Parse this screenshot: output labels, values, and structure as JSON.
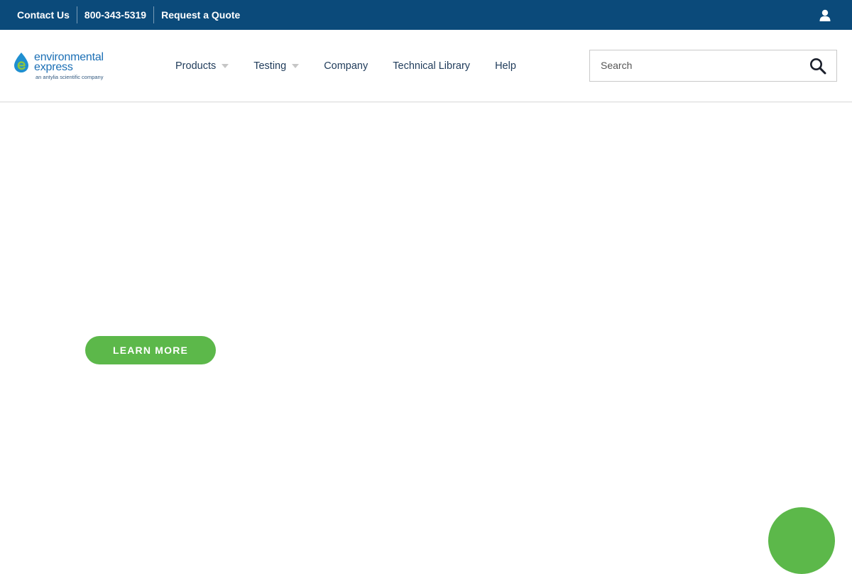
{
  "topbar": {
    "contact_label": "Contact Us",
    "phone_label": "800-343-5319",
    "quote_label": "Request a Quote",
    "background": "#0b4a7a"
  },
  "logo": {
    "line1": "environmental",
    "line2": "express",
    "tagline": "an antylia scientific company"
  },
  "nav": {
    "products": "Products",
    "testing": "Testing",
    "company": "Company",
    "technical_library": "Technical Library",
    "help": "Help"
  },
  "search": {
    "placeholder": "Search",
    "value": ""
  },
  "hero": {
    "cta_label": "LEARN MORE",
    "accent": "#5cb84a"
  },
  "icons": {
    "user": "user-icon",
    "search": "search-icon",
    "dropdown": "chevron-down-icon"
  }
}
